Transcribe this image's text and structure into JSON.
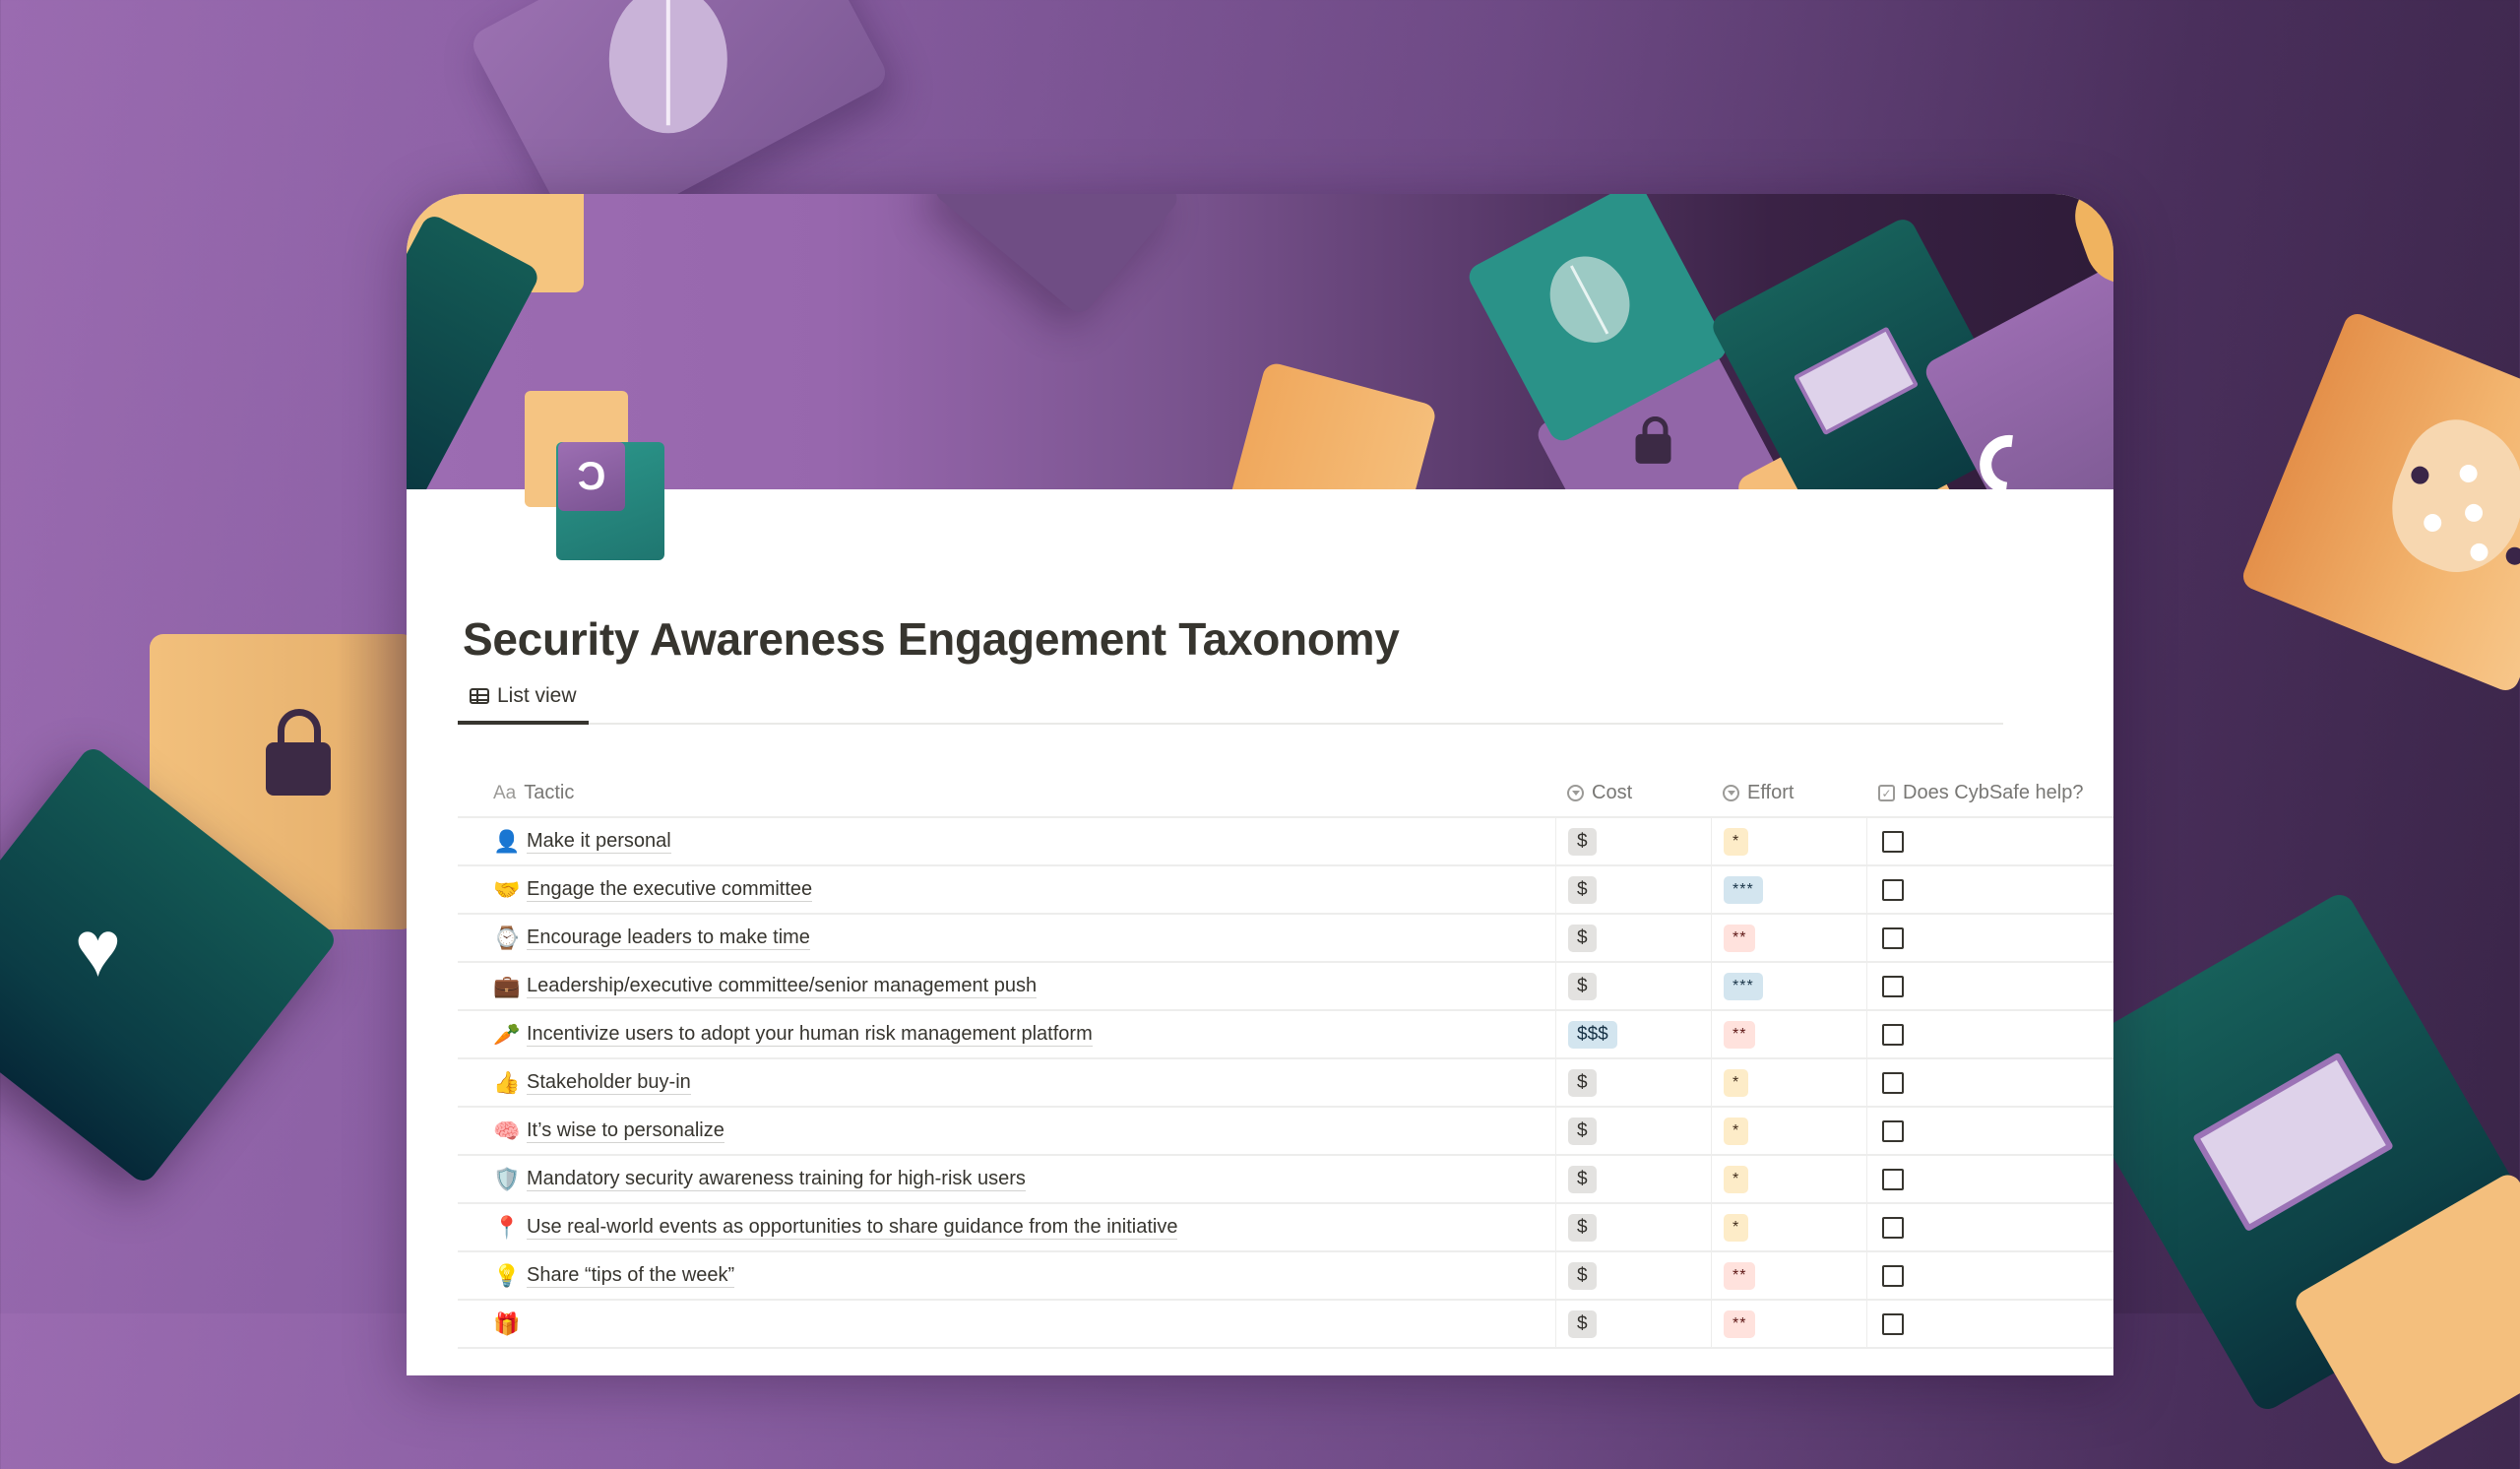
{
  "page": {
    "title": "Security Awareness Engagement Taxonomy",
    "page_icon": "cybsafe-puzzle-heads-icon",
    "page_icon_glyph": "Ɔ"
  },
  "tabs": [
    {
      "label": "List view",
      "icon": "table-icon",
      "active": true
    }
  ],
  "table": {
    "columns": [
      {
        "key": "tactic",
        "label": "Tactic",
        "icon_text": "Aa"
      },
      {
        "key": "cost",
        "label": "Cost",
        "icon": "select-icon"
      },
      {
        "key": "effort",
        "label": "Effort",
        "icon": "select-icon"
      },
      {
        "key": "help",
        "label": "Does CybSafe help?",
        "icon": "checkbox-icon"
      }
    ],
    "rows": [
      {
        "emoji": "👤",
        "tactic": "Make it personal",
        "cost": "$",
        "cost_color": "gray",
        "effort": "*",
        "effort_color": "yellow",
        "help": false
      },
      {
        "emoji": "🤝",
        "tactic": "Engage the executive committee",
        "cost": "$",
        "cost_color": "gray",
        "effort": "***",
        "effort_color": "blue",
        "help": false
      },
      {
        "emoji": "⌚",
        "tactic": "Encourage leaders to make time",
        "cost": "$",
        "cost_color": "gray",
        "effort": "**",
        "effort_color": "red",
        "help": false
      },
      {
        "emoji": "💼",
        "tactic": "Leadership/executive committee/senior management push",
        "cost": "$",
        "cost_color": "gray",
        "effort": "***",
        "effort_color": "blue",
        "help": false
      },
      {
        "emoji": "🥕",
        "tactic": "Incentivize users to adopt your human risk management platform",
        "cost": "$$$",
        "cost_color": "blue",
        "effort": "**",
        "effort_color": "red",
        "help": false
      },
      {
        "emoji": "👍",
        "tactic": "Stakeholder buy-in",
        "cost": "$",
        "cost_color": "gray",
        "effort": "*",
        "effort_color": "yellow",
        "help": false
      },
      {
        "emoji": "🧠",
        "tactic": "It’s wise to personalize",
        "cost": "$",
        "cost_color": "gray",
        "effort": "*",
        "effort_color": "yellow",
        "help": false
      },
      {
        "emoji": "🛡️",
        "tactic": "Mandatory security awareness training for high-risk users",
        "cost": "$",
        "cost_color": "gray",
        "effort": "*",
        "effort_color": "yellow",
        "help": false
      },
      {
        "emoji": "📍",
        "tactic": "Use real-world events as opportunities to share guidance from the initiative",
        "cost": "$",
        "cost_color": "gray",
        "effort": "*",
        "effort_color": "yellow",
        "help": false
      },
      {
        "emoji": "💡",
        "tactic": "Share “tips of the week”",
        "cost": "$",
        "cost_color": "gray",
        "effort": "**",
        "effort_color": "red",
        "help": false
      },
      {
        "emoji": "🎁",
        "tactic": "",
        "cost": "$",
        "cost_color": "gray",
        "effort": "**",
        "effort_color": "red",
        "help": false
      }
    ]
  },
  "colors": {
    "accent_purple": "#9c6cb2",
    "teal": "#2a9288",
    "dark_green": "#145b55",
    "tan": "#f5c482",
    "text": "#37352f",
    "muted": "#787774"
  }
}
